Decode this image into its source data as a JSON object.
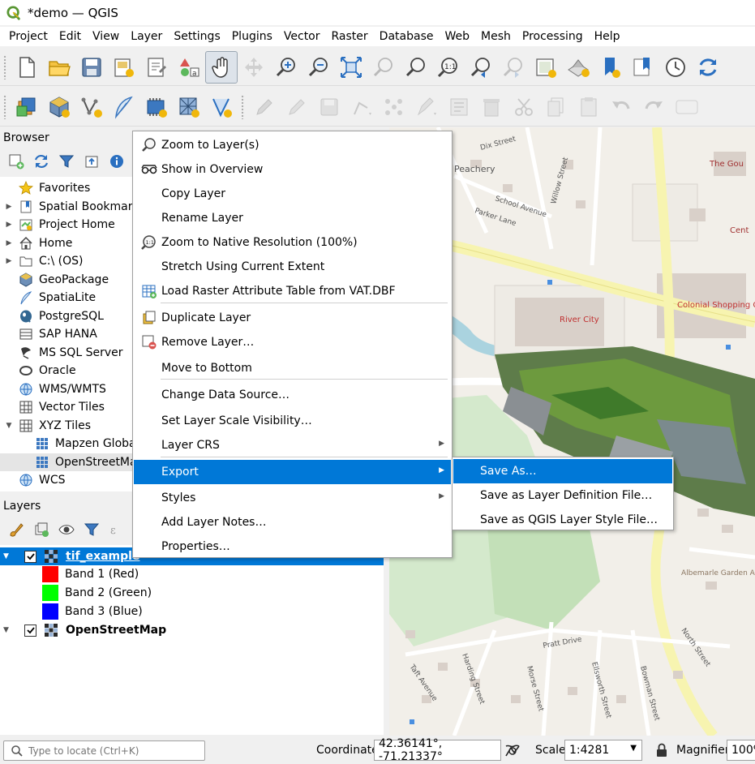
{
  "window": {
    "title": "*demo — QGIS"
  },
  "menubar": [
    "Project",
    "Edit",
    "View",
    "Layer",
    "Settings",
    "Plugins",
    "Vector",
    "Raster",
    "Database",
    "Web",
    "Mesh",
    "Processing",
    "Help"
  ],
  "browser": {
    "title": "Browser",
    "items": [
      {
        "label": "Favorites",
        "icon": "star-icon",
        "arrow": "",
        "indent": 0
      },
      {
        "label": "Spatial Bookmarks",
        "icon": "bookmark-icon",
        "arrow": "right",
        "indent": 0
      },
      {
        "label": "Project Home",
        "icon": "project-home-icon",
        "arrow": "right",
        "indent": 0
      },
      {
        "label": "Home",
        "icon": "home-icon",
        "arrow": "right",
        "indent": 0
      },
      {
        "label": "C:\\ (OS)",
        "icon": "folder-icon",
        "arrow": "right",
        "indent": 0
      },
      {
        "label": "GeoPackage",
        "icon": "geopackage-icon",
        "arrow": "",
        "indent": 0
      },
      {
        "label": "SpatiaLite",
        "icon": "spatialite-icon",
        "arrow": "",
        "indent": 0
      },
      {
        "label": "PostgreSQL",
        "icon": "postgresql-icon",
        "arrow": "",
        "indent": 0
      },
      {
        "label": "SAP HANA",
        "icon": "sap-hana-icon",
        "arrow": "",
        "indent": 0
      },
      {
        "label": "MS SQL Server",
        "icon": "mssql-icon",
        "arrow": "",
        "indent": 0
      },
      {
        "label": "Oracle",
        "icon": "oracle-icon",
        "arrow": "",
        "indent": 0
      },
      {
        "label": "WMS/WMTS",
        "icon": "wms-icon",
        "arrow": "",
        "indent": 0
      },
      {
        "label": "Vector Tiles",
        "icon": "vector-tiles-icon",
        "arrow": "",
        "indent": 0
      },
      {
        "label": "XYZ Tiles",
        "icon": "xyz-tiles-icon",
        "arrow": "down",
        "indent": 0
      },
      {
        "label": "Mapzen Global Terrain",
        "icon": "grid-tile-icon",
        "arrow": "",
        "indent": 1
      },
      {
        "label": "OpenStreetMap",
        "icon": "grid-tile-icon",
        "arrow": "",
        "indent": 1
      },
      {
        "label": "WCS",
        "icon": "wcs-icon",
        "arrow": "",
        "indent": 0
      }
    ]
  },
  "layers": {
    "title": "Layers",
    "items": [
      {
        "label": "tif_example",
        "type": "raster",
        "checked": true,
        "expanded": true,
        "selected": true
      },
      {
        "label": "Band 1 (Red)",
        "type": "band",
        "color": "#ff0000"
      },
      {
        "label": "Band 2 (Green)",
        "type": "band",
        "color": "#00ff00"
      },
      {
        "label": "Band 3 (Blue)",
        "type": "band",
        "color": "#0000ff"
      },
      {
        "label": "OpenStreetMap",
        "type": "raster",
        "checked": true,
        "expanded": true,
        "selected": false
      }
    ]
  },
  "context_menu": {
    "items": [
      {
        "label": "Zoom to Layer(s)",
        "icon": "zoom-layer-icon",
        "mnemonic": "Z"
      },
      {
        "label": "Show in Overview",
        "icon": "overview-icon",
        "mnemonic": "O"
      },
      {
        "label": "Copy Layer",
        "icon": "",
        "mnemonic": ""
      },
      {
        "label": "Rename Layer",
        "icon": "",
        "mnemonic": "n"
      },
      {
        "label": "Zoom to Native Resolution (100%)",
        "icon": "zoom-native-icon",
        "mnemonic": "N"
      },
      {
        "label": "Stretch Using Current Extent",
        "icon": "",
        "mnemonic": "S"
      },
      {
        "label": "Load Raster Attribute Table from VAT.DBF",
        "icon": "attribute-table-icon",
        "mnemonic": ""
      },
      {
        "label": "Duplicate Layer",
        "icon": "duplicate-icon",
        "mnemonic": "D"
      },
      {
        "label": "Remove Layer…",
        "icon": "remove-layer-icon",
        "mnemonic": "R"
      },
      {
        "label": "Move to Bottom",
        "icon": "",
        "mnemonic": "B"
      },
      {
        "label": "Change Data Source…",
        "icon": "",
        "mnemonic": "h"
      },
      {
        "label": "Set Layer Scale Visibility…",
        "icon": "",
        "mnemonic": "V"
      },
      {
        "label": "Layer CRS",
        "icon": "",
        "mnemonic": "",
        "submenu": true
      },
      {
        "label": "Export",
        "icon": "",
        "mnemonic": "",
        "submenu": true,
        "highlighted": true
      },
      {
        "label": "Styles",
        "icon": "",
        "mnemonic": "",
        "submenu": true
      },
      {
        "label": "Add Layer Notes…",
        "icon": "",
        "mnemonic": ""
      },
      {
        "label": "Properties…",
        "icon": "",
        "mnemonic": "P"
      }
    ]
  },
  "export_submenu": {
    "items": [
      {
        "label": "Save As…",
        "highlighted": true
      },
      {
        "label": "Save as Layer Definition File…",
        "highlighted": false
      },
      {
        "label": "Save as QGIS Layer Style File…",
        "highlighted": false
      }
    ]
  },
  "statusbar": {
    "locator_placeholder": "Type to locate (Ctrl+K)",
    "coordinate_label": "Coordinate",
    "coordinate_value": "42.36141°, -71.21337°",
    "scale_label": "Scale",
    "scale_value": "1:4281",
    "magnifier_label": "Magnifier",
    "magnifier_value": "100%"
  },
  "map_labels": {
    "dix_street": "Dix Street",
    "peachery": "Peachery",
    "school_avenue": "School Avenue",
    "parker_lane": "Parker Lane",
    "willow_street": "Willow Street",
    "river_city": "River City",
    "colonial_shopping_center": "Colonial Shopping Center",
    "albemarle_garden": "Albemarle Garden Apartments",
    "north_street": "North Street",
    "pratt_drive": "Pratt Drive",
    "harding_street": "Harding Street",
    "morse_street": "Morse Street",
    "ellsworth_street": "Ellsworth Street",
    "bowman_street": "Bowman Street",
    "taft_avenue": "Taft Avenue",
    "the_gou": "The Gou",
    "cent": "Cent"
  },
  "colors": {
    "accent": "#0078d7",
    "map_bg": "#f2efe9",
    "building": "#d9d0c9",
    "road_major": "#f7f4b0",
    "water": "#aad3df",
    "park": "#c8e7c1"
  }
}
